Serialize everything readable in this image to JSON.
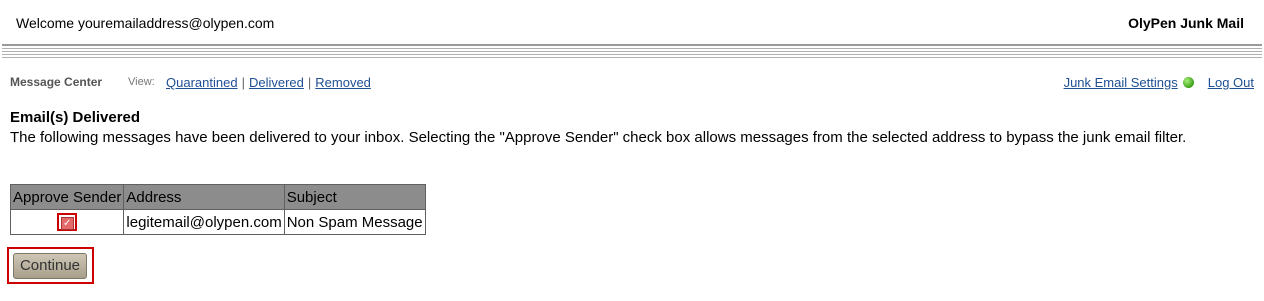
{
  "header": {
    "welcome": "Welcome youremailaddress@olypen.com",
    "brand": "OlyPen Junk Mail"
  },
  "nav": {
    "section_label": "Message Center",
    "view_label": "View:",
    "links": [
      "Quarantined",
      "Delivered",
      "Removed"
    ],
    "separator": "|",
    "junk_settings": "Junk Email Settings",
    "logout": "Log Out"
  },
  "page": {
    "title": "Email(s) Delivered",
    "description": "The following messages have been delivered to your inbox. Selecting the \"Approve Sender\" check box allows messages from the selected address to bypass the junk email filter."
  },
  "table": {
    "headers": [
      "Approve Sender",
      "Address",
      "Subject"
    ],
    "rows": [
      {
        "approve": true,
        "address": "legitemail@olypen.com",
        "subject": "Non Spam Message"
      }
    ]
  },
  "actions": {
    "continue_label": "Continue"
  },
  "colors": {
    "link": "#1f4f94",
    "header_bg": "#8c8c8c",
    "highlight": "#cc0000",
    "status_ok": "#3ba017"
  },
  "icons": {
    "status": "green-status-dot-icon",
    "checkbox": "checked-checkbox-icon"
  }
}
